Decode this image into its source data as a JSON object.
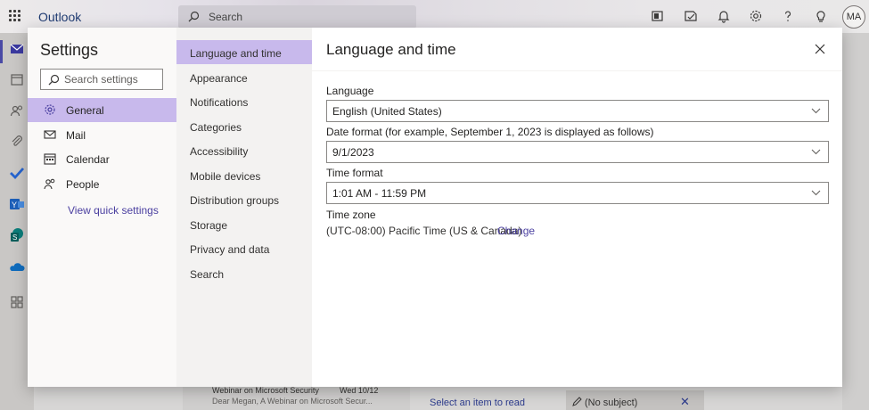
{
  "header": {
    "app_name": "Outlook",
    "search_placeholder": "Search",
    "avatar_initials": "MA",
    "icons": [
      "waffle-icon",
      "office-icon",
      "tasks-icon",
      "bell-icon",
      "gear-icon",
      "help-icon",
      "lightbulb-icon"
    ]
  },
  "rail": {
    "items": [
      "mail-icon",
      "calendar-icon",
      "people-icon",
      "attach-icon",
      "todo-icon",
      "yammer-icon",
      "sharepoint-icon",
      "onedrive-icon",
      "apps-icon"
    ]
  },
  "background": {
    "mail_subject": "Webinar on Microsoft Security",
    "mail_date": "Wed 10/12",
    "mail_preview": "Dear Megan, A Webinar on Microsoft Secur...",
    "reading_pane_text": "Select an item to read",
    "draft_subject": "(No subject)"
  },
  "settings": {
    "title": "Settings",
    "search_placeholder": "Search settings",
    "categories": [
      {
        "label": "General",
        "icon": "gear-icon",
        "active": true
      },
      {
        "label": "Mail",
        "icon": "mail-icon",
        "active": false
      },
      {
        "label": "Calendar",
        "icon": "calendar-icon",
        "active": false
      },
      {
        "label": "People",
        "icon": "people-icon",
        "active": false
      }
    ],
    "quick_settings_link": "View quick settings",
    "subcategories": [
      {
        "label": "Language and time",
        "active": true
      },
      {
        "label": "Appearance"
      },
      {
        "label": "Notifications"
      },
      {
        "label": "Categories"
      },
      {
        "label": "Accessibility"
      },
      {
        "label": "Mobile devices"
      },
      {
        "label": "Distribution groups"
      },
      {
        "label": "Storage"
      },
      {
        "label": "Privacy and data"
      },
      {
        "label": "Search"
      }
    ]
  },
  "pane": {
    "title": "Language and time",
    "language_label": "Language",
    "language_value": "English (United States)",
    "date_format_label": "Date format (for example, September 1, 2023 is displayed as follows)",
    "date_format_value": "9/1/2023",
    "time_format_label": "Time format",
    "time_format_value": "1:01 AM - 11:59 PM",
    "time_zone_label": "Time zone",
    "time_zone_value": "(UTC-08:00) Pacific Time (US & Canada)",
    "time_zone_change": "Change"
  },
  "colors": {
    "accent": "#c8b9ec",
    "link": "#4a3fa0",
    "brand_text": "#1f3b72"
  }
}
